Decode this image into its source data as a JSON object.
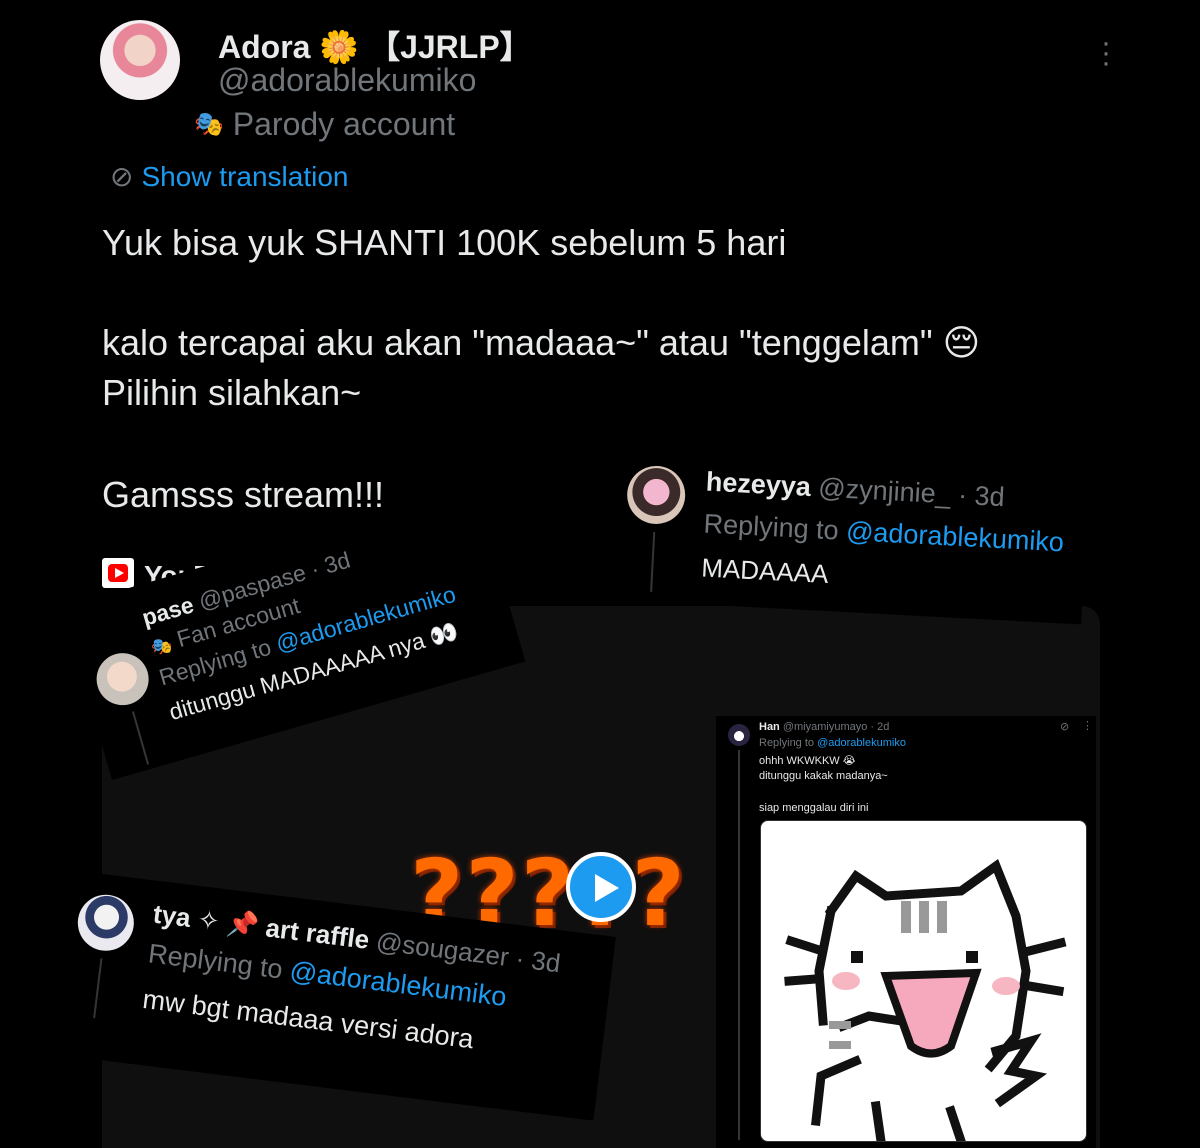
{
  "tweet": {
    "display_name": "Adora",
    "name_emoji": "🌼",
    "name_tag": "【JJRLP】",
    "handle": "@adorablekumiko",
    "parody_label": "Parody account",
    "parody_icon": "mask-icon",
    "show_translation": "Show translation",
    "more_icon": "more-icon",
    "body": [
      "Yuk bisa yuk SHANTI 100K sebelum 5 hari",
      "kalo tercapai aku akan \"madaaa~\" atau \"tenggelam\" 😔",
      "Pilihin silahkan~",
      "Gamsss stream!!!"
    ],
    "embed_source": "YouTube",
    "video_overlay_text": "?????",
    "accent_color": "#1d9bf0"
  },
  "replies": {
    "hezeyya": {
      "name": "hezeyya",
      "handle": "@zynjinie_",
      "time": "· 3d",
      "replying_prefix": "Replying to",
      "replying_handle": "@adorablekumiko",
      "text": "MADAAAA"
    },
    "pase": {
      "name": "pase",
      "handle": "@paspase",
      "time": "· 3d",
      "badge": "Fan account",
      "replying_prefix": "Replying to",
      "replying_handle": "@adorablekumiko",
      "text": "ditunggu MADAAAAA nya 👀"
    },
    "tya": {
      "name": "tya ✧ 📌 art raffle",
      "handle": "@sougazer",
      "time": "· 3d",
      "replying_prefix": "Replying to",
      "replying_handle": "@adorablekumiko",
      "text": "mw bgt madaaa versi adora"
    },
    "han": {
      "name": "Han",
      "handle": "@miyamiyumayo",
      "time": "· 2d",
      "replying_prefix": "Replying to",
      "replying_handle": "@adorablekumiko",
      "lines": [
        "ohhh WKWKKW 😭",
        "ditunggu kakak madanya~",
        "siap menggalau diri ini"
      ]
    }
  }
}
